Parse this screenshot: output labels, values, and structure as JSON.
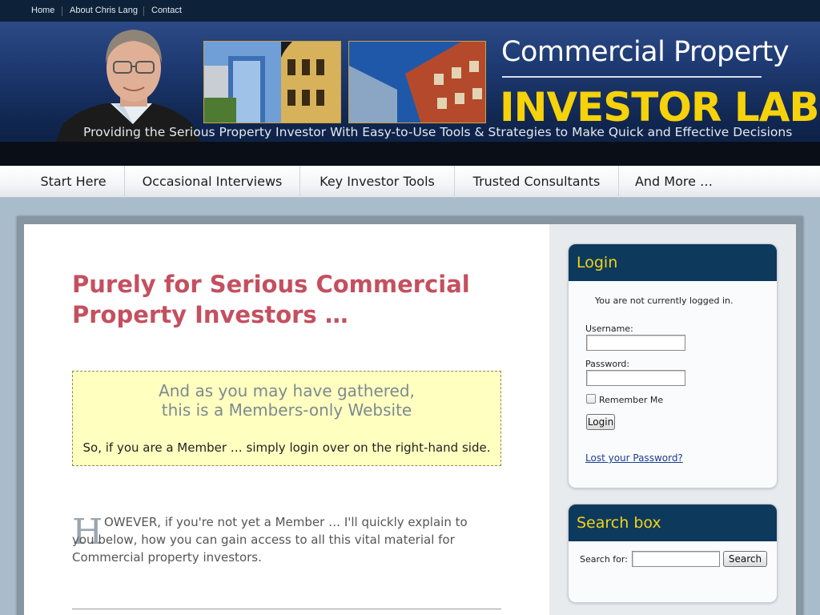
{
  "topnav": {
    "home": "Home",
    "about": "About Chris Lang",
    "contact": "Contact"
  },
  "header": {
    "logo_line1": "Commercial Property",
    "logo_line2": "INVESTOR LAB",
    "tagline": "Providing the Serious Property Investor With Easy-to-Use Tools & Strategies to Make Quick and Effective Decisions"
  },
  "nav": {
    "items": [
      "Start Here",
      "Occasional Interviews",
      "Key Investor Tools",
      "Trusted Consultants",
      "And More …"
    ]
  },
  "main": {
    "heading": "Purely for Serious Commercial Property Investors …",
    "notice_line1": "And as you may have gathered,",
    "notice_line2": "this is a Members-only Website",
    "notice_text": "So, if you are a Member … simply login over on the right-hand side.",
    "dropcap": "H",
    "body_text": "OWEVER, if you're not yet a Member … I'll quickly explain to you below, how you can gain access to all this vital material for Commercial property investors."
  },
  "login": {
    "title": "Login",
    "status": "You are not currently logged in.",
    "username_label": "Username:",
    "password_label": "Password:",
    "remember_label": "Remember Me",
    "login_button": "Login",
    "lost_password": "Lost your Password?"
  },
  "search": {
    "title": "Search box",
    "label": "Search for:",
    "button": "Search"
  },
  "colors": {
    "topbar": "#0d2238",
    "logo_yellow": "#f5d20a",
    "heading_red": "#c4505f",
    "widget_title_bg": "#0d3a5c",
    "notice_bg": "#ffffc0"
  }
}
